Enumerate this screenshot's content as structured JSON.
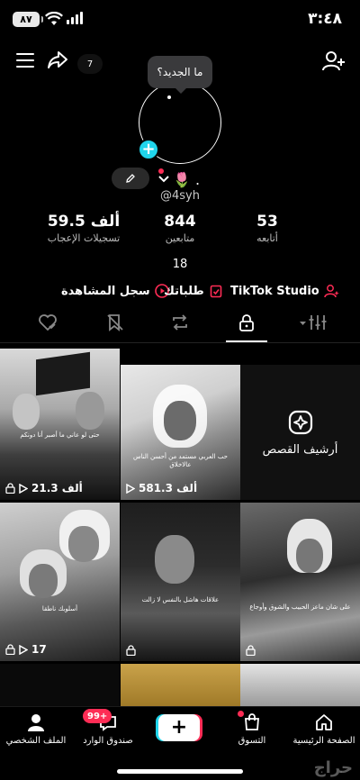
{
  "status_bar": {
    "time": "٣:٤٨",
    "battery": "٨٧"
  },
  "header": {
    "notification_count": "7",
    "bubble_text": "ما الجديد؟"
  },
  "profile": {
    "display_name": "🌷 .",
    "username": "@4syh",
    "stats": [
      {
        "value": "59.5 ألف",
        "label": "تسجيلات الإعجاب"
      },
      {
        "value": "844",
        "label": "متابعين"
      },
      {
        "value": "53",
        "label": "أتابعه"
      }
    ],
    "extra_number": "18"
  },
  "links": {
    "history": "سجل المشاهدة",
    "orders": "طلباتك",
    "studio": "TikTok Studio"
  },
  "archive_label": "أرشيف القصص",
  "videos": [
    {
      "views": "581.3 ألف",
      "caption": "حب العربي مستمد من أحسن الناس عالاخلاق"
    },
    {
      "views": "21.3 ألف",
      "caption": "حتى لو عاني ما أصبر أنا دونكم"
    },
    {
      "views": "",
      "caption": "على شان ماعز الحبيب والشوق وأوجاع"
    },
    {
      "views": "",
      "caption": "علاقات هاشل بالنفس لا زالت"
    },
    {
      "views": "17",
      "caption": "أسلوبك ناطقا"
    }
  ],
  "bottom_nav": {
    "home": "الصفحة الرئيسية",
    "shop": "التسوق",
    "inbox": "صندوق الوارد",
    "inbox_badge": "99+",
    "profile": "الملف الشخصي"
  },
  "watermark": "حراج"
}
